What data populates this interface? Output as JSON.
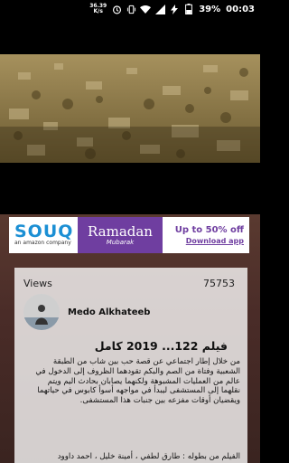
{
  "status_bar": {
    "net_speed_value": "36.39",
    "net_speed_unit": "K/s",
    "battery_percent": "39%",
    "time": "00:03",
    "icons": [
      "alarm-icon",
      "vibrate-icon",
      "wifi-icon",
      "signal-icon",
      "charging-icon",
      "battery-icon"
    ]
  },
  "video": {
    "thumbnail": "desert-village-aerial"
  },
  "ad": {
    "brand": "SOUQ",
    "brand_sub": "an amazon company",
    "event_title": "Ramadan",
    "event_sub": "Mubarak",
    "offer": "Up to 50% off",
    "cta": "Download app",
    "colors": {
      "souq_blue": "#1b8fd4",
      "ramadan_purple": "#6f3ea0"
    }
  },
  "stats": {
    "views_label": "Views",
    "views_count": "75753"
  },
  "channel": {
    "name": "Medo Alkhateeb"
  },
  "video_info": {
    "title": "فيلم 122... 2019  كامل",
    "description": "من خلال إطار اجتماعي عن قصة حب بين شاب من الطبقة الشعبية وفتاة من الصم والبكم  تقودهما الظروف إلى الدخول في عالم من العمليات المشبوهة  ولكنهما يصابان بحادث اليم ويتم نقلهما إلى المستشفى ليبدأ في مواجهه أسوأ كابوس في حياتهما ويقضيان أوقات مفزعه بين جنبات هذا المستشفى.",
    "cast": "الفيلم من بطوله : طارق لطفي ، أمينة خليل ، احمد داوود"
  }
}
